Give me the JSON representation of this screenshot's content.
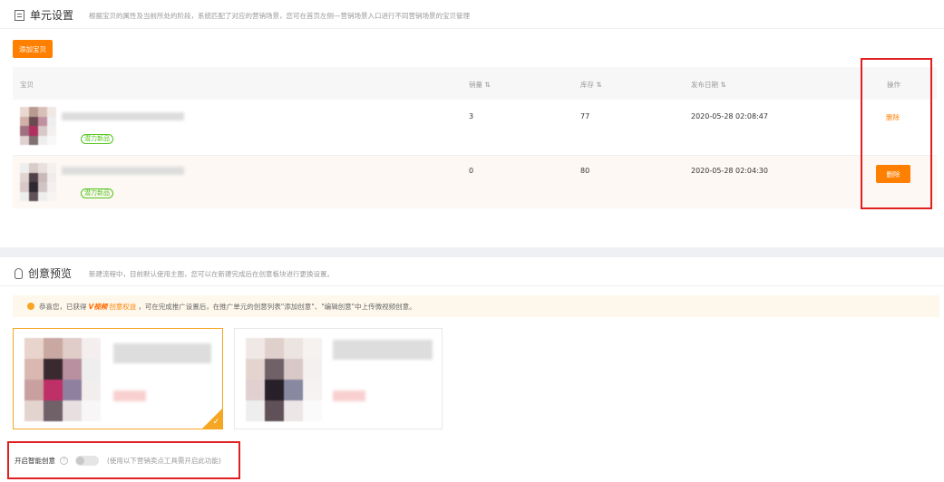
{
  "unit_settings": {
    "title": "单元设置",
    "description": "根据宝贝的属性及当前所处的阶段，系统匹配了对应的营销场景，您可在首页左侧—营销场景入口进行不同营销场景的宝贝管理",
    "add_button": "添加宝贝"
  },
  "table": {
    "headers": {
      "item": "宝贝",
      "sales": "销量 ⇅",
      "stock": "库存 ⇅",
      "date": "发布日期 ⇅",
      "action": "操作"
    },
    "rows": [
      {
        "tag": "潜力新品",
        "sales": "3",
        "stock": "77",
        "date": "2020-05-28 02:08:47",
        "action": "删除"
      },
      {
        "tag": "潜力新品",
        "sales": "0",
        "stock": "80",
        "date": "2020-05-28 02:04:30",
        "action": "删除"
      }
    ]
  },
  "creative_preview": {
    "title": "创意预览",
    "description": "新建流程中，目前默认使用主图，您可以在新建完成后在创意板块进行更换设置。",
    "notice": {
      "prefix": "恭喜您，已获得",
      "brand": "V视频",
      "link": "创意权益",
      "suffix": "，可在完成推广设置后，在推广单元的创意列表\"添加创意\"、\"编辑创意\"中上传微视频创意。"
    }
  },
  "smart_creative": {
    "label": "开启智能创意",
    "toggle_on": false,
    "hint": "(使用以下营销卖点工具需开启此功能)"
  },
  "colors": {
    "accent": "#ff8000",
    "highlight": "#e02020"
  }
}
